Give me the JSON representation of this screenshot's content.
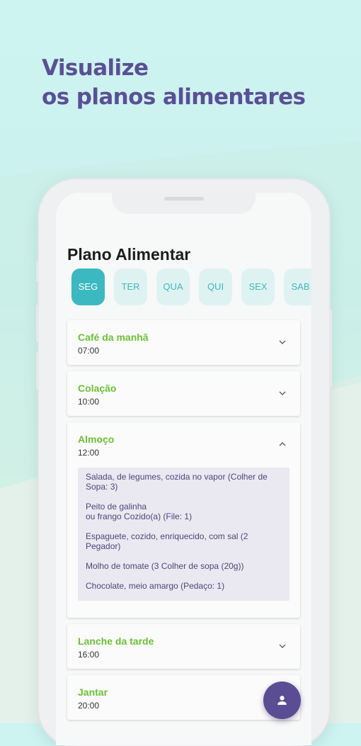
{
  "promo": {
    "headline_line1": "Visualize",
    "headline_line2": "os planos alimentares"
  },
  "app": {
    "title": "Plano Alimentar",
    "days": [
      {
        "label": "SEG",
        "active": true
      },
      {
        "label": "TER",
        "active": false
      },
      {
        "label": "QUA",
        "active": false
      },
      {
        "label": "QUI",
        "active": false
      },
      {
        "label": "SEX",
        "active": false
      },
      {
        "label": "SAB",
        "active": false
      }
    ],
    "meals": [
      {
        "name": "Café da manhã",
        "time": "07:00",
        "expanded": false
      },
      {
        "name": "Colação",
        "time": "10:00",
        "expanded": false
      },
      {
        "name": "Almoço",
        "time": "12:00",
        "expanded": true,
        "foods": [
          "Salada, de legumes, cozida no vapor (Colher de\nSopa: 3)",
          "Peito de galinha\nou frango Cozido(a) (File: 1)",
          "Espaguete, cozido, enriquecido, com sal (2\nPegador)",
          "Molho de tomate (3 Colher de sopa (20g))",
          "Chocolate, meio amargo (Pedaço: 1)"
        ]
      },
      {
        "name": "Lanche da tarde",
        "time": "16:00",
        "expanded": false
      },
      {
        "name": "Jantar",
        "time": "20:00",
        "expanded": false
      }
    ],
    "fab_icon": "person-icon"
  },
  "colors": {
    "headline": "#5b4f95",
    "meal_name": "#6cc035",
    "day_active": "#3cb9c0",
    "fab": "#5a4d94"
  }
}
